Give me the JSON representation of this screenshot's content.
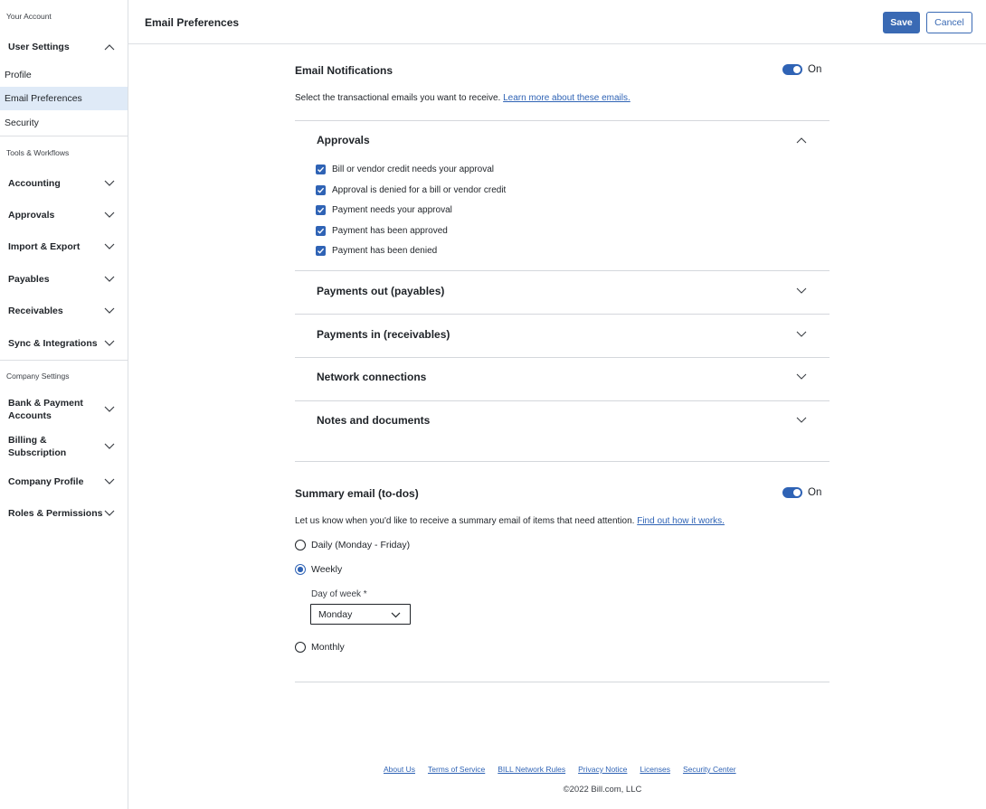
{
  "sidebar": {
    "your_account": "Your Account",
    "user_settings": "User Settings",
    "profile": "Profile",
    "email_preferences": "Email Preferences",
    "security": "Security",
    "tools_workflows": "Tools & Workflows",
    "accounting": "Accounting",
    "approvals": "Approvals",
    "import_export": "Import & Export",
    "payables": "Payables",
    "receivables": "Receivables",
    "sync_integrations": "Sync & Integrations",
    "company_settings": "Company Settings",
    "bank_payment_1": "Bank & Payment",
    "bank_payment_2": "Accounts",
    "billing_1": "Billing &",
    "billing_2": "Subscription",
    "company_profile": "Company Profile",
    "roles_permissions": "Roles & Permissions"
  },
  "header": {
    "title": "Email Preferences",
    "save_label": "Save",
    "cancel_label": "Cancel"
  },
  "email_notifications": {
    "title": "Email Notifications",
    "toggle_label": "On",
    "description": "Select the transactional emails you want to receive.",
    "learn_more": "Learn more about these emails.",
    "approvals_title": "Approvals",
    "approvals_items": [
      "Bill or vendor credit needs your approval",
      "Approval is denied for a bill or vendor credit",
      "Payment needs your approval",
      "Payment has been approved",
      "Payment has been denied"
    ],
    "payments_out": "Payments out (payables)",
    "payments_in": "Payments in (receivables)",
    "network_connections": "Network connections",
    "notes_documents": "Notes and documents"
  },
  "summary_email": {
    "title": "Summary email (to-dos)",
    "toggle_label": "On",
    "description": "Let us know when you'd like to receive a summary email of items that need attention.",
    "find_out": "Find out how it works.",
    "option_daily": "Daily (Monday - Friday)",
    "option_weekly": "Weekly",
    "day_of_week_label": "Day of week *",
    "day_of_week_value": "Monday",
    "option_monthly": "Monthly",
    "selected": "Weekly"
  },
  "footer": {
    "links": [
      "About Us",
      "Terms of Service",
      "BILL Network Rules",
      "Privacy Notice",
      "Licenses",
      "Security Center"
    ],
    "copyright": "©2022 Bill.com, LLC"
  },
  "colors": {
    "accent": "#2f63b5",
    "save_button": "#3a6ab4",
    "active_sidebar": "#dfeaf7"
  }
}
